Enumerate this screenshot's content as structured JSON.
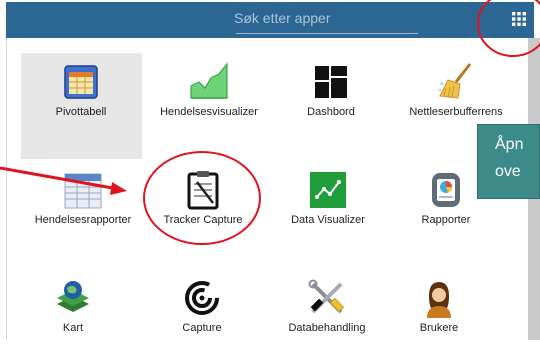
{
  "search": {
    "placeholder": "Søk etter apper"
  },
  "apps": [
    {
      "label": "Pivottabell",
      "icon": "pivot-table-icon"
    },
    {
      "label": "Hendelsesvisualizer",
      "icon": "area-chart-icon"
    },
    {
      "label": "Dashbord",
      "icon": "dashboard-icon"
    },
    {
      "label": "Nettleserbufferrens",
      "icon": "broom-icon"
    },
    {
      "label": "Hendelsesrapporter",
      "icon": "spreadsheet-icon"
    },
    {
      "label": "Tracker Capture",
      "icon": "clipboard-icon"
    },
    {
      "label": "Data Visualizer",
      "icon": "line-chart-icon"
    },
    {
      "label": "Rapporter",
      "icon": "report-icon"
    },
    {
      "label": "Kart",
      "icon": "map-layers-icon"
    },
    {
      "label": "Capture",
      "icon": "capture-icon"
    },
    {
      "label": "Databehandling",
      "icon": "tools-icon"
    },
    {
      "label": "Brukere",
      "icon": "user-icon"
    }
  ],
  "tooltip": {
    "line1": "Åpn",
    "line2": "ove"
  },
  "colors": {
    "header": "#2c6693",
    "annotation_red": "#e0141e",
    "tooltip_bg": "#3c8a8a"
  }
}
